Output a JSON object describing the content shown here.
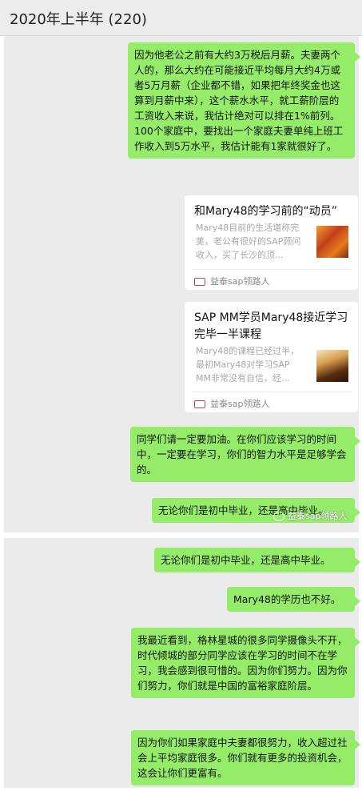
{
  "header": {
    "title": "2020年上半年 (220)"
  },
  "messages_top": [
    "因为他老公之前有大约3万税后月薪。夫妻两个人的，那么大约在可能接近平均每月大约4万或者5万月薪（企业都不错，如果把年终奖金也这算到月薪中来），这个薪水水平，就工薪阶层的工资收入来说，我估计绝对可以排在1%前列。 100个家庭中，要找出一个家庭夫妻单纯上班工作收入到5万水平，我估计能有1家就很好了。"
  ],
  "cards": [
    {
      "title": "和Mary48的学习前的“动员”",
      "desc": "Mary48目前的生活堪称完美，老公有很好的SAP顾问收入，买了长沙的顶...",
      "source": "益泰sap领路人"
    },
    {
      "title": "SAP MM学员Mary48接近学习完毕一半课程",
      "desc": "Mary48的课程已经过半，最初Mary48对学习SAP MM非常没有自信，经...",
      "source": "益泰sap领路人"
    }
  ],
  "messages_mid": [
    "同学们请一定要加油。在你们应该学习的时间中，一定要在学习，你们的智力水平是足够学会的。",
    "无论你们是初中毕业，还是高中毕业。"
  ],
  "watermark": "益泰sap领路人",
  "messages_bottom": [
    "无论你们是初中毕业，还是高中毕业。",
    "Mary48的学历也不好。",
    "我最近看到，格林星城的很多同学摄像头不开，时代倾城的部分同学应该在学习的时间不在学习，我会感到很可惜的。因为你们努力。因为你们努力，你们就是中国的富裕家庭阶层。",
    "因为你们如果家庭中夫妻都很努力，收入超过社会上平均家庭很多。你们就有更多的投资机会，这会让你们更富有。"
  ]
}
